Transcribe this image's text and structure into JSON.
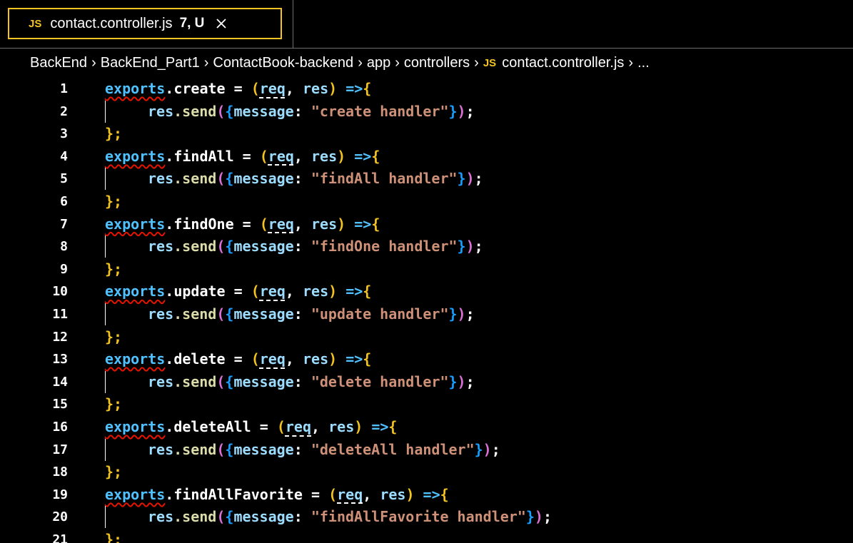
{
  "tab": {
    "lang_badge": "JS",
    "filename": "contact.controller.js",
    "status": "7, U",
    "close_icon": "close-icon"
  },
  "breadcrumb": {
    "items": [
      "BackEnd",
      "BackEnd_Part1",
      "ContactBook-backend",
      "app",
      "controllers"
    ],
    "file_badge": "JS",
    "file": "contact.controller.js",
    "more": "..."
  },
  "colors": {
    "tab_border": "#f3c322",
    "keyword_blue": "#4fc1ff",
    "string": "#ce9178",
    "error_squiggle": "#e51400"
  },
  "code": {
    "lines": [
      {
        "n": "1",
        "kind": "head",
        "exports": "exports",
        "name": ".create = ",
        "p1": "(",
        "req": "req",
        "mid": ", ",
        "res": "res",
        "p2": ")",
        "arrow": " =>",
        "brace": "{"
      },
      {
        "n": "2",
        "kind": "body",
        "obj": "res",
        "method": ".send",
        "open": "(",
        "bopen": "{",
        "key": "message",
        "colon": ": ",
        "str": "\"create handler\"",
        "bclose": "}",
        "close": ")",
        "semi": ";"
      },
      {
        "n": "3",
        "kind": "end",
        "text": "};"
      },
      {
        "n": "4",
        "kind": "head",
        "exports": "exports",
        "name": ".findAll = ",
        "p1": "(",
        "req": "req",
        "mid": ", ",
        "res": "res",
        "p2": ")",
        "arrow": " =>",
        "brace": "{"
      },
      {
        "n": "5",
        "kind": "body",
        "obj": "res",
        "method": ".send",
        "open": "(",
        "bopen": "{",
        "key": "message",
        "colon": ": ",
        "str": "\"findAll handler\"",
        "bclose": "}",
        "close": ")",
        "semi": ";"
      },
      {
        "n": "6",
        "kind": "end",
        "text": "};"
      },
      {
        "n": "7",
        "kind": "head",
        "exports": "exports",
        "name": ".findOne = ",
        "p1": "(",
        "req": "req",
        "mid": ", ",
        "res": "res",
        "p2": ")",
        "arrow": " =>",
        "brace": "{"
      },
      {
        "n": "8",
        "kind": "body",
        "obj": "res",
        "method": ".send",
        "open": "(",
        "bopen": "{",
        "key": "message",
        "colon": ": ",
        "str": "\"findOne handler\"",
        "bclose": "}",
        "close": ")",
        "semi": ";"
      },
      {
        "n": "9",
        "kind": "end",
        "text": "};"
      },
      {
        "n": "10",
        "kind": "head",
        "exports": "exports",
        "name": ".update = ",
        "p1": "(",
        "req": "req",
        "mid": ", ",
        "res": "res",
        "p2": ")",
        "arrow": " =>",
        "brace": "{"
      },
      {
        "n": "11",
        "kind": "body",
        "obj": "res",
        "method": ".send",
        "open": "(",
        "bopen": "{",
        "key": "message",
        "colon": ": ",
        "str": "\"update handler\"",
        "bclose": "}",
        "close": ")",
        "semi": ";"
      },
      {
        "n": "12",
        "kind": "end",
        "text": "};"
      },
      {
        "n": "13",
        "kind": "head",
        "exports": "exports",
        "name": ".delete = ",
        "p1": "(",
        "req": "req",
        "mid": ", ",
        "res": "res",
        "p2": ")",
        "arrow": " =>",
        "brace": "{"
      },
      {
        "n": "14",
        "kind": "body",
        "obj": "res",
        "method": ".send",
        "open": "(",
        "bopen": "{",
        "key": "message",
        "colon": ": ",
        "str": "\"delete handler\"",
        "bclose": "}",
        "close": ")",
        "semi": ";"
      },
      {
        "n": "15",
        "kind": "end",
        "text": "};"
      },
      {
        "n": "16",
        "kind": "head",
        "exports": "exports",
        "name": ".deleteAll = ",
        "p1": "(",
        "req": "req",
        "mid": ", ",
        "res": "res",
        "p2": ")",
        "arrow": " =>",
        "brace": "{"
      },
      {
        "n": "17",
        "kind": "body",
        "obj": "res",
        "method": ".send",
        "open": "(",
        "bopen": "{",
        "key": "message",
        "colon": ": ",
        "str": "\"deleteAll handler\"",
        "bclose": "}",
        "close": ")",
        "semi": ";"
      },
      {
        "n": "18",
        "kind": "end",
        "text": "};"
      },
      {
        "n": "19",
        "kind": "head",
        "exports": "exports",
        "name": ".findAllFavorite = ",
        "p1": "(",
        "req": "req",
        "mid": ", ",
        "res": "res",
        "p2": ")",
        "arrow": " =>",
        "brace": "{"
      },
      {
        "n": "20",
        "kind": "body",
        "obj": "res",
        "method": ".send",
        "open": "(",
        "bopen": "{",
        "key": "message",
        "colon": ": ",
        "str": "\"findAllFavorite handler\"",
        "bclose": "}",
        "close": ")",
        "semi": ";"
      },
      {
        "n": "21",
        "kind": "end",
        "text": "};"
      }
    ]
  }
}
